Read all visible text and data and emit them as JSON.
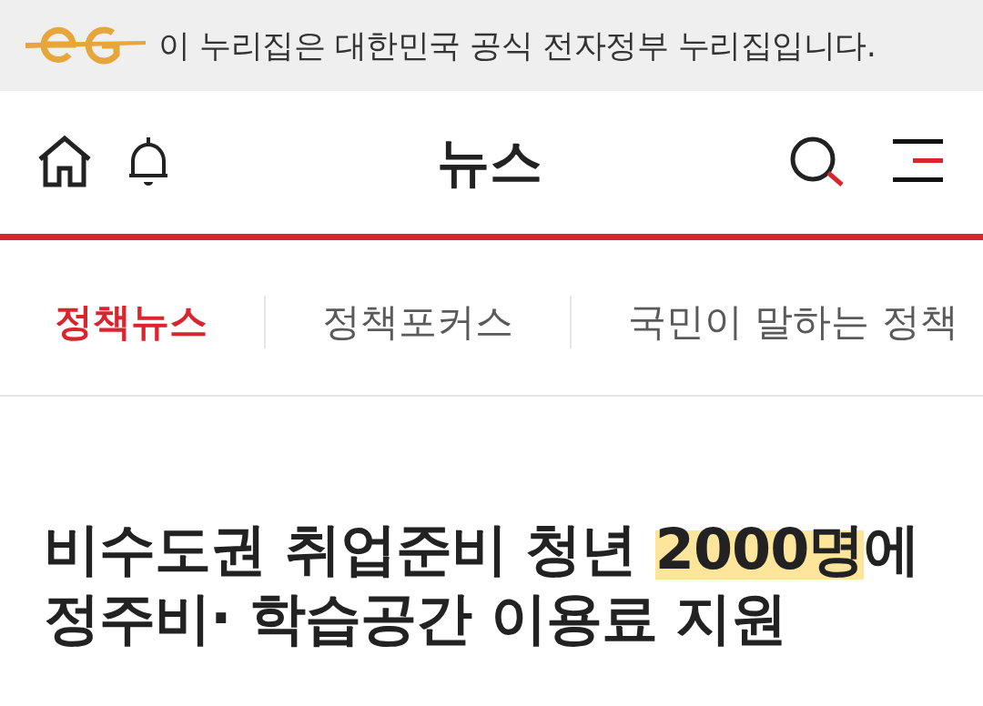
{
  "gov_banner": {
    "text": "이 누리집은 대한민국 공식 전자정부 누리집입니다."
  },
  "header": {
    "title": "뉴스"
  },
  "tabs": [
    {
      "label": "정책뉴스",
      "selected": true
    },
    {
      "label": "정책포커스",
      "selected": false
    },
    {
      "label": "국민이 말하는 정책",
      "selected": false
    }
  ],
  "article": {
    "headline": [
      {
        "text": "비수도권 취업준비 청년 ",
        "highlighted": false
      },
      {
        "text": "2000명",
        "highlighted": true
      },
      {
        "text": "에 정주비· 학습공간 이용료 지원",
        "highlighted": false
      }
    ]
  }
}
